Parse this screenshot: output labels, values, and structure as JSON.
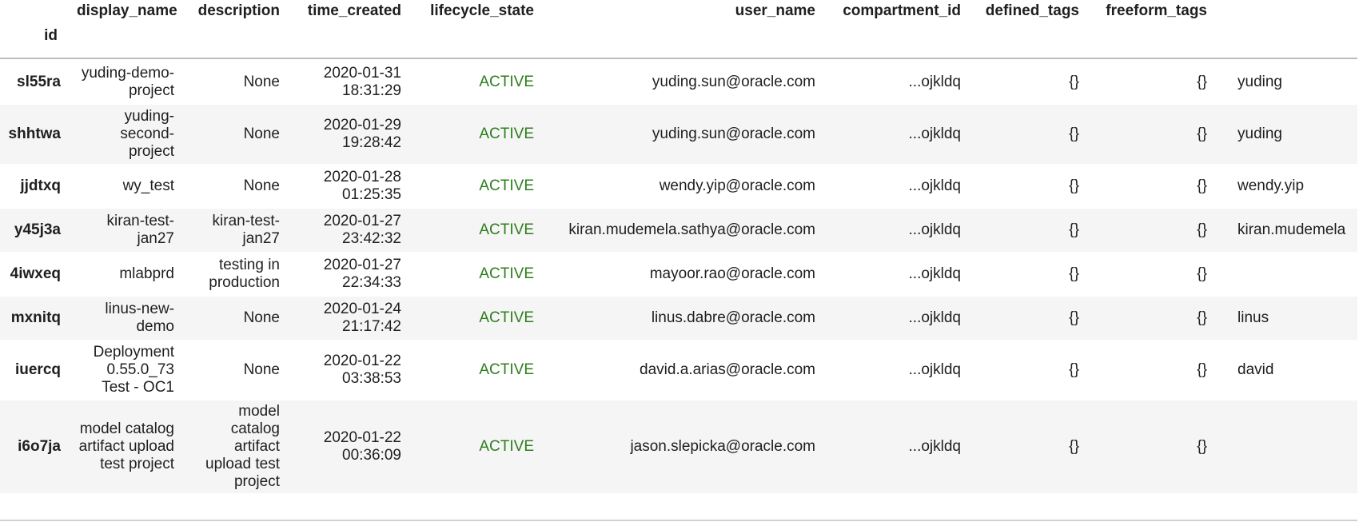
{
  "table": {
    "index_name": "id",
    "columns": [
      {
        "key": "display_name",
        "label": "display_name"
      },
      {
        "key": "description",
        "label": "description"
      },
      {
        "key": "time_created",
        "label": "time_created"
      },
      {
        "key": "lifecycle_state",
        "label": "lifecycle_state"
      },
      {
        "key": "user_name",
        "label": "user_name"
      },
      {
        "key": "compartment_id",
        "label": "compartment_id"
      },
      {
        "key": "defined_tags",
        "label": "defined_tags"
      },
      {
        "key": "freeform_tags",
        "label": "freeform_tags"
      },
      {
        "key": "extra",
        "label": ""
      }
    ],
    "rows": [
      {
        "id": "sl55ra",
        "display_name": "yuding-demo-project",
        "description": "None",
        "time_created": "2020-01-31 18:31:29",
        "lifecycle_state": "ACTIVE",
        "user_name": "yuding.sun@oracle.com",
        "compartment_id": "...ojkldq",
        "defined_tags": "{}",
        "freeform_tags": "{}",
        "extra": "yuding"
      },
      {
        "id": "shhtwa",
        "display_name": "yuding-second-project",
        "description": "None",
        "time_created": "2020-01-29 19:28:42",
        "lifecycle_state": "ACTIVE",
        "user_name": "yuding.sun@oracle.com",
        "compartment_id": "...ojkldq",
        "defined_tags": "{}",
        "freeform_tags": "{}",
        "extra": "yuding"
      },
      {
        "id": "jjdtxq",
        "display_name": "wy_test",
        "description": "None",
        "time_created": "2020-01-28 01:25:35",
        "lifecycle_state": "ACTIVE",
        "user_name": "wendy.yip@oracle.com",
        "compartment_id": "...ojkldq",
        "defined_tags": "{}",
        "freeform_tags": "{}",
        "extra": "wendy.yip"
      },
      {
        "id": "y45j3a",
        "display_name": "kiran-test-jan27",
        "description": "kiran-test-jan27",
        "time_created": "2020-01-27 23:42:32",
        "lifecycle_state": "ACTIVE",
        "user_name": "kiran.mudemela.sathya@oracle.com",
        "compartment_id": "...ojkldq",
        "defined_tags": "{}",
        "freeform_tags": "{}",
        "extra": "kiran.mudemela"
      },
      {
        "id": "4iwxeq",
        "display_name": "mlabprd",
        "description": "testing in production",
        "time_created": "2020-01-27 22:34:33",
        "lifecycle_state": "ACTIVE",
        "user_name": "mayoor.rao@oracle.com",
        "compartment_id": "...ojkldq",
        "defined_tags": "{}",
        "freeform_tags": "{}",
        "extra": ""
      },
      {
        "id": "mxnitq",
        "display_name": "linus-new-demo",
        "description": "None",
        "time_created": "2020-01-24 21:17:42",
        "lifecycle_state": "ACTIVE",
        "user_name": "linus.dabre@oracle.com",
        "compartment_id": "...ojkldq",
        "defined_tags": "{}",
        "freeform_tags": "{}",
        "extra": "linus"
      },
      {
        "id": "iuercq",
        "display_name": "Deployment 0.55.0_73 Test - OC1",
        "description": "None",
        "time_created": "2020-01-22 03:38:53",
        "lifecycle_state": "ACTIVE",
        "user_name": "david.a.arias@oracle.com",
        "compartment_id": "...ojkldq",
        "defined_tags": "{}",
        "freeform_tags": "{}",
        "extra": "david"
      },
      {
        "id": "i6o7ja",
        "display_name": "model catalog artifact upload test project",
        "description": "model catalog artifact upload test project",
        "time_created": "2020-01-22 00:36:09",
        "lifecycle_state": "ACTIVE",
        "user_name": "jason.slepicka@oracle.com",
        "compartment_id": "...ojkldq",
        "defined_tags": "{}",
        "freeform_tags": "{}",
        "extra": ""
      }
    ]
  },
  "colors": {
    "active_state": "#2e7d1e",
    "row_stripe": "#f5f5f5",
    "header_rule": "#bdbdbd"
  }
}
